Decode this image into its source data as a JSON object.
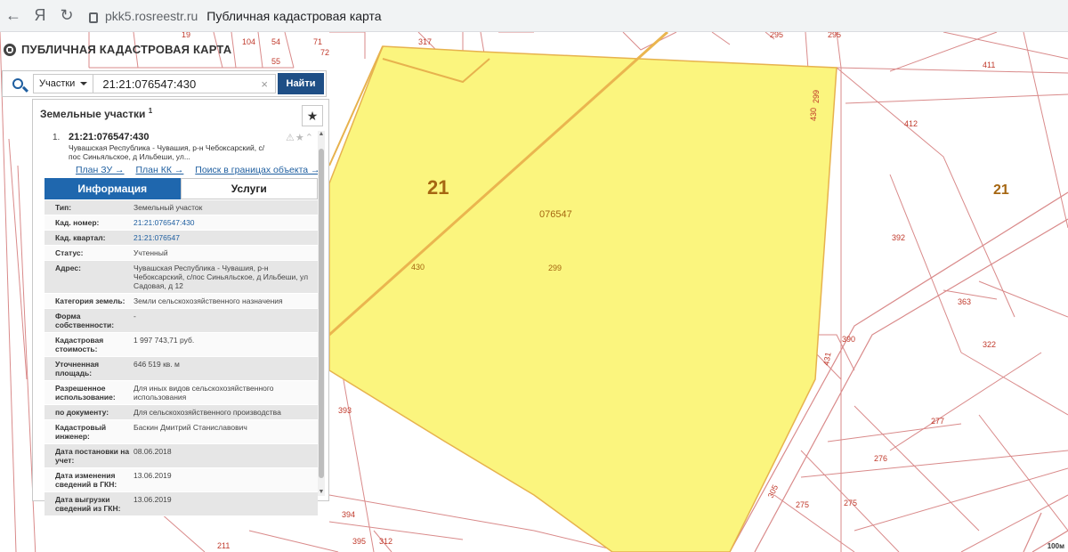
{
  "browser": {
    "back_glyph": "←",
    "yandex_glyph": "Я",
    "reload_glyph": "↻",
    "domain": "pkk5.rosreestr.ru",
    "page_title": "Публичная кадастровая карта"
  },
  "app": {
    "title": "ПУБЛИЧНАЯ КАДАСТРОВАЯ КАРТА",
    "search": {
      "type_label": "Участки",
      "query": "21:21:076547:430",
      "clear_glyph": "×",
      "find_label": "Найти"
    }
  },
  "panel": {
    "heading": "Земельные участки",
    "heading_count": "1",
    "star_glyph": "★",
    "result": {
      "index": "1.",
      "cad_number": "21:21:076547:430",
      "address_short": "Чувашская Республика - Чувашия, р-н Чебоксарский, с/пос Синьяльское, д Ильбеши, ул...",
      "icons": "⚠★⌃",
      "links": [
        "План ЗУ →",
        "План КК →",
        "Поиск в границах объекта →"
      ]
    },
    "tabs": [
      "Информация",
      "Услуги"
    ],
    "info_rows": [
      {
        "label": "Тип:",
        "value": "Земельный участок"
      },
      {
        "label": "Кад. номер:",
        "value": "21:21:076547:430"
      },
      {
        "label": "Кад. квартал:",
        "value": "21:21:076547"
      },
      {
        "label": "Статус:",
        "value": "Учтенный"
      },
      {
        "label": "Адрес:",
        "value": "Чувашская Республика - Чувашия, р-н Чебоксарский, с/пос Синьяльское, д Ильбеши, ул Садовая, д 12"
      },
      {
        "label": "Категория земель:",
        "value": "Земли сельскохозяйственного назначения"
      },
      {
        "label": "Форма собственности:",
        "value": "-"
      },
      {
        "label": "Кадастровая стоимость:",
        "value": "1 997 743,71 руб."
      },
      {
        "label": "Уточненная площадь:",
        "value": "646 519 кв. м"
      },
      {
        "label": "Разрешенное использование:",
        "value": "Для иных видов сельскохозяйственного использования"
      },
      {
        "label": "по документу:",
        "value": "Для сельскохозяйственного производства"
      },
      {
        "label": "Кадастровый инженер:",
        "value": "Баскин Дмитрий Станиславович"
      },
      {
        "label": "Дата постановки на учет:",
        "value": "08.06.2018"
      },
      {
        "label": "Дата изменения сведений в ГКН:",
        "value": "13.06.2019"
      },
      {
        "label": "Дата выгрузки сведений из ГКН:",
        "value": "13.06.2019"
      }
    ]
  },
  "map": {
    "district_label": "21",
    "district_label_right": "21",
    "quarter_label": "076547",
    "parcel_labels": [
      "430",
      "299",
      "430",
      "299",
      "412",
      "411",
      "392",
      "363",
      "322",
      "390",
      "431",
      "277",
      "276",
      "275",
      "275",
      "305",
      "393",
      "394",
      "395",
      "312",
      "211",
      "317",
      "295",
      "295",
      "19",
      "104",
      "54",
      "55",
      "71",
      "72"
    ],
    "highlight_color": "#fbf57e",
    "scale_label": "100м"
  }
}
